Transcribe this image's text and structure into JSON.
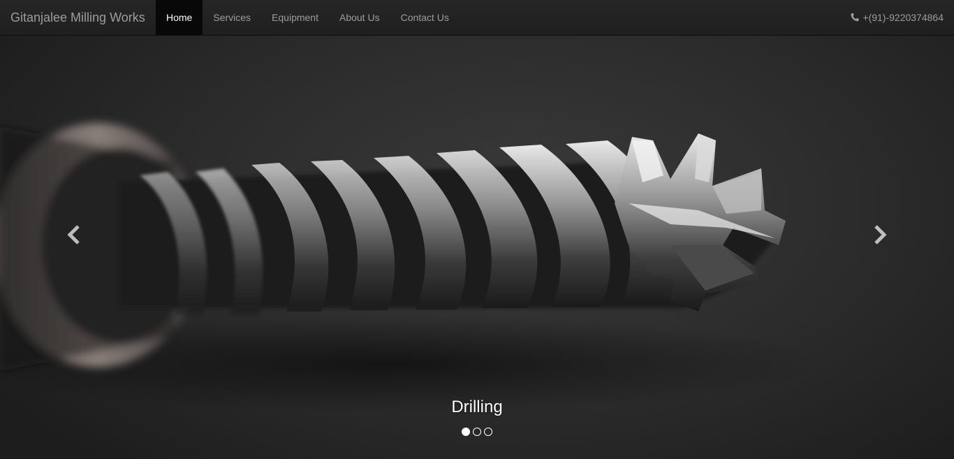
{
  "navbar": {
    "brand": "Gitanjalee Milling Works",
    "items": [
      {
        "label": "Home",
        "active": true
      },
      {
        "label": "Services",
        "active": false
      },
      {
        "label": "Equipment",
        "active": false
      },
      {
        "label": "About Us",
        "active": false
      },
      {
        "label": "Contact Us",
        "active": false
      }
    ],
    "phone": "+(91)-9220374864",
    "phone_icon": "phone-icon"
  },
  "carousel": {
    "caption": "Drilling",
    "slide_count": 3,
    "active_slide": 1,
    "prev_icon": "chevron-left-icon",
    "next_icon": "chevron-right-icon",
    "image": "end-mill-drill-bit"
  }
}
